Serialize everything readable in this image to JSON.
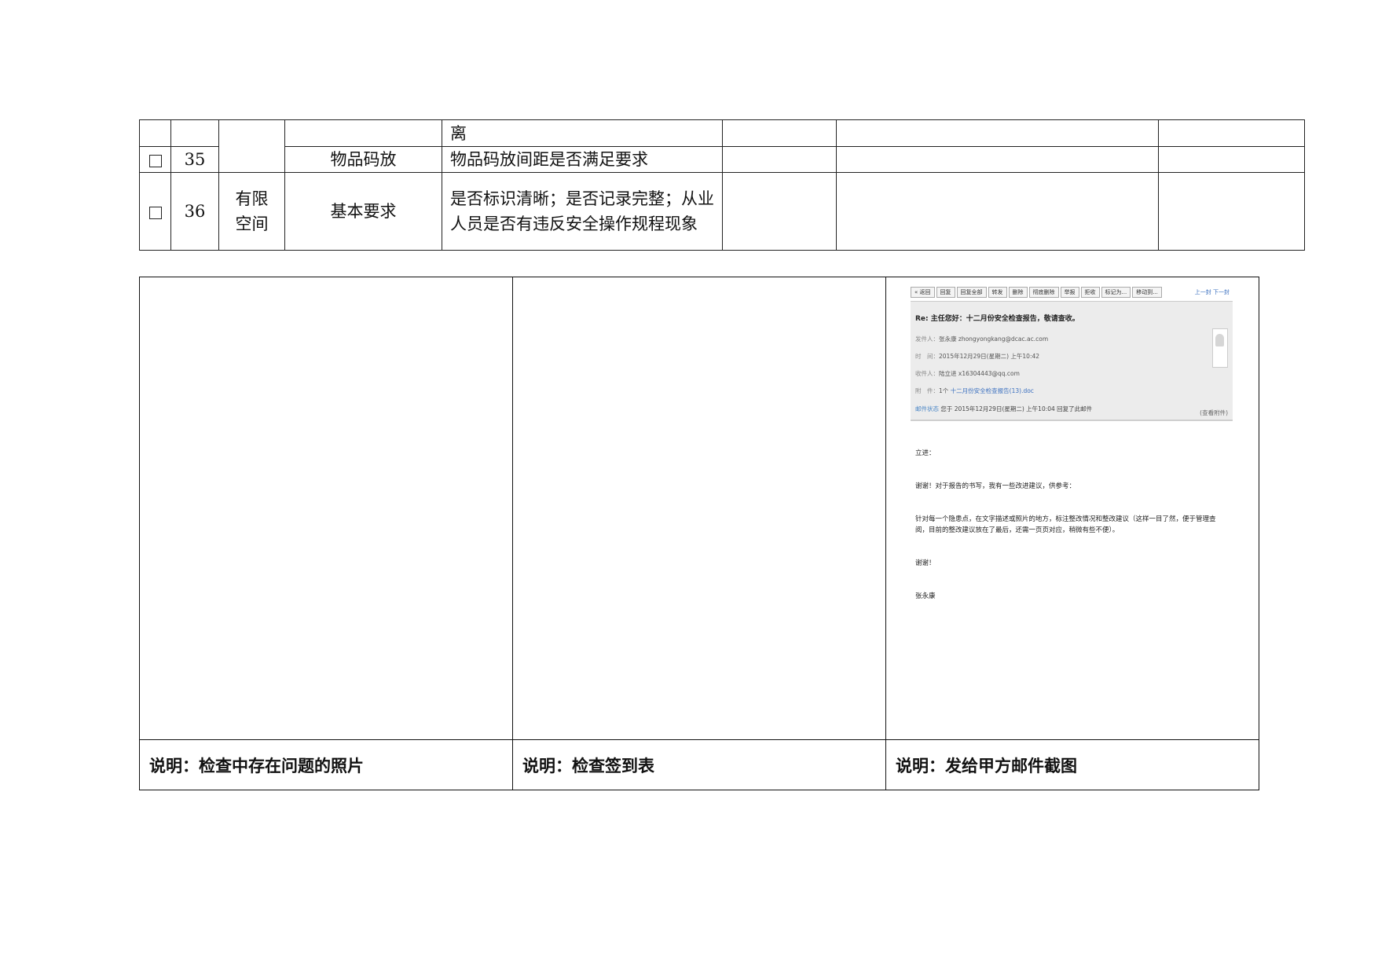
{
  "checklist": {
    "rows": [
      {
        "num": "",
        "category": "",
        "subcategory": "",
        "item": "离"
      },
      {
        "num": "35",
        "subcategory": "物品码放",
        "item": "物品码放间距是否满足要求"
      },
      {
        "num": "36",
        "category_line1": "有限",
        "category_line2": "空间",
        "subcategory": "基本要求",
        "item": "是否标识清晰；是否记录完整；从业人员是否有违反安全操作规程现象"
      }
    ]
  },
  "photos": {
    "captions": [
      "说明：检查中存在问题的照片",
      "说明：检查签到表",
      "说明：发给甲方邮件截图"
    ]
  },
  "email_screenshot": {
    "toolbar": [
      "« 返回",
      "回复",
      "回复全部",
      "转发",
      "删除",
      "彻底删除",
      "举报",
      "拒收",
      "标记为...",
      "移动到..."
    ],
    "toolbar_right": "上一封 下一封",
    "subject": "Re: 主任您好：十二月份安全检查报告，敬请查收。",
    "from_label": "发件人：",
    "from_value": "张永康 zhongyongkang@dcac.ac.com",
    "time_label": "时　间：",
    "time_value": "2015年12月29日(星期二) 上午10:42",
    "to_label": "收件人：",
    "to_value": "陆立进 x16304443@qq.com",
    "attach_label": "附　件：",
    "attach_count": "1个",
    "attach_value": "十二月份安全检查报告(13).doc",
    "forward": "(查看附件)",
    "note_label": "邮件状态",
    "note_value": "您于 2015年12月29日(星期二) 上午10:04 回复了此邮件",
    "greeting": "立进：",
    "para1": "谢谢！对于报告的书写，我有一些改进建议，供参考：",
    "para2": "针对每一个隐患点，在文字描述或照片的地方，标注整改情况和整改建议（这样一目了然，便于管理查阅，目前的整改建议放在了最后，还需一页页对应，稍微有些不便）。",
    "thanks": "谢谢！",
    "signature": "张永康"
  }
}
